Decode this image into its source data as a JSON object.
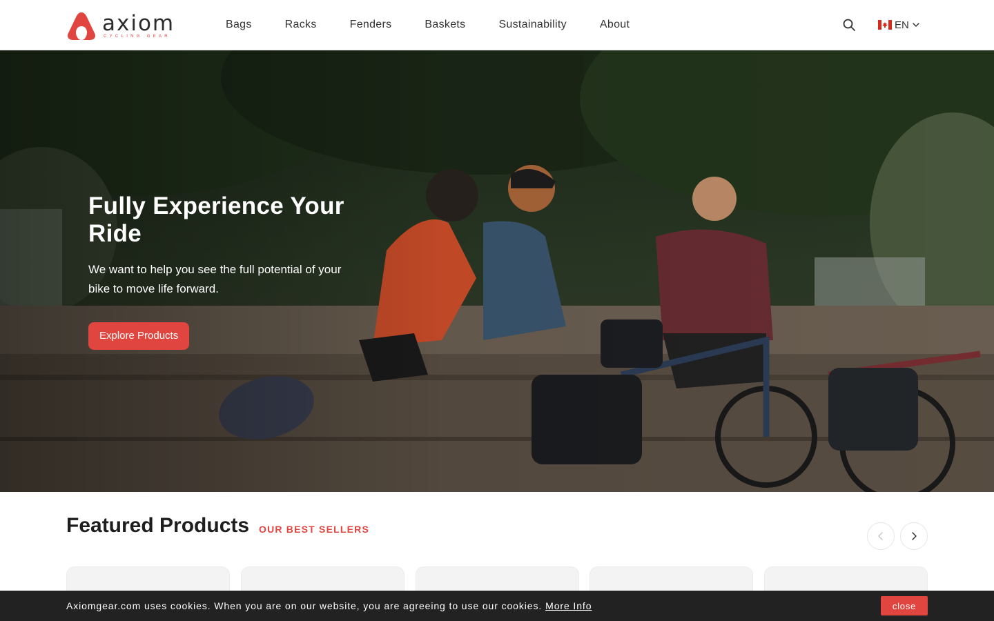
{
  "brand": {
    "name": "axiom",
    "tagline": "CYCLING GEAR",
    "accent_color": "#e0453f"
  },
  "nav": {
    "items": [
      {
        "label": "Bags"
      },
      {
        "label": "Racks"
      },
      {
        "label": "Fenders"
      },
      {
        "label": "Baskets"
      },
      {
        "label": "Sustainability"
      },
      {
        "label": "About"
      }
    ]
  },
  "header": {
    "search_icon": "search-icon",
    "language": {
      "flag": "canada-flag-icon",
      "label": "EN"
    }
  },
  "hero": {
    "title": "Fully Experience Your Ride",
    "subtitle": "We want to help you see the full potential of your bike to move life forward.",
    "cta_label": "Explore Products"
  },
  "featured": {
    "title": "Featured Products",
    "tag": "OUR BEST SELLERS",
    "prev_icon": "chevron-left-icon",
    "next_icon": "chevron-right-icon",
    "card_count_visible": 5
  },
  "cookie_bar": {
    "text": "Axiomgear.com uses cookies. When you are on our website, you are agreeing to use our cookies.",
    "link_label": "More Info",
    "close_label": "close"
  }
}
